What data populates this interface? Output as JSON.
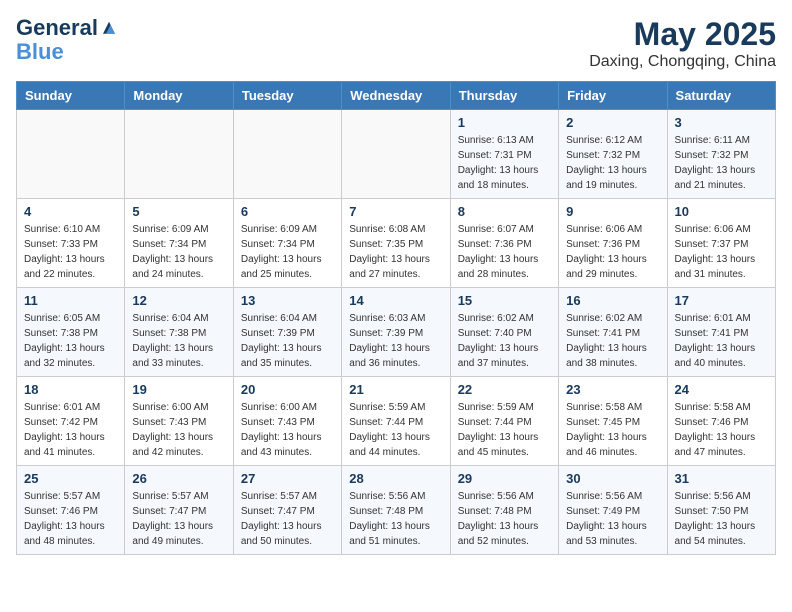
{
  "logo": {
    "line1": "General",
    "line2": "Blue"
  },
  "title": "May 2025",
  "location": "Daxing, Chongqing, China",
  "weekdays": [
    "Sunday",
    "Monday",
    "Tuesday",
    "Wednesday",
    "Thursday",
    "Friday",
    "Saturday"
  ],
  "weeks": [
    [
      {
        "day": "",
        "detail": ""
      },
      {
        "day": "",
        "detail": ""
      },
      {
        "day": "",
        "detail": ""
      },
      {
        "day": "",
        "detail": ""
      },
      {
        "day": "1",
        "detail": "Sunrise: 6:13 AM\nSunset: 7:31 PM\nDaylight: 13 hours\nand 18 minutes."
      },
      {
        "day": "2",
        "detail": "Sunrise: 6:12 AM\nSunset: 7:32 PM\nDaylight: 13 hours\nand 19 minutes."
      },
      {
        "day": "3",
        "detail": "Sunrise: 6:11 AM\nSunset: 7:32 PM\nDaylight: 13 hours\nand 21 minutes."
      }
    ],
    [
      {
        "day": "4",
        "detail": "Sunrise: 6:10 AM\nSunset: 7:33 PM\nDaylight: 13 hours\nand 22 minutes."
      },
      {
        "day": "5",
        "detail": "Sunrise: 6:09 AM\nSunset: 7:34 PM\nDaylight: 13 hours\nand 24 minutes."
      },
      {
        "day": "6",
        "detail": "Sunrise: 6:09 AM\nSunset: 7:34 PM\nDaylight: 13 hours\nand 25 minutes."
      },
      {
        "day": "7",
        "detail": "Sunrise: 6:08 AM\nSunset: 7:35 PM\nDaylight: 13 hours\nand 27 minutes."
      },
      {
        "day": "8",
        "detail": "Sunrise: 6:07 AM\nSunset: 7:36 PM\nDaylight: 13 hours\nand 28 minutes."
      },
      {
        "day": "9",
        "detail": "Sunrise: 6:06 AM\nSunset: 7:36 PM\nDaylight: 13 hours\nand 29 minutes."
      },
      {
        "day": "10",
        "detail": "Sunrise: 6:06 AM\nSunset: 7:37 PM\nDaylight: 13 hours\nand 31 minutes."
      }
    ],
    [
      {
        "day": "11",
        "detail": "Sunrise: 6:05 AM\nSunset: 7:38 PM\nDaylight: 13 hours\nand 32 minutes."
      },
      {
        "day": "12",
        "detail": "Sunrise: 6:04 AM\nSunset: 7:38 PM\nDaylight: 13 hours\nand 33 minutes."
      },
      {
        "day": "13",
        "detail": "Sunrise: 6:04 AM\nSunset: 7:39 PM\nDaylight: 13 hours\nand 35 minutes."
      },
      {
        "day": "14",
        "detail": "Sunrise: 6:03 AM\nSunset: 7:39 PM\nDaylight: 13 hours\nand 36 minutes."
      },
      {
        "day": "15",
        "detail": "Sunrise: 6:02 AM\nSunset: 7:40 PM\nDaylight: 13 hours\nand 37 minutes."
      },
      {
        "day": "16",
        "detail": "Sunrise: 6:02 AM\nSunset: 7:41 PM\nDaylight: 13 hours\nand 38 minutes."
      },
      {
        "day": "17",
        "detail": "Sunrise: 6:01 AM\nSunset: 7:41 PM\nDaylight: 13 hours\nand 40 minutes."
      }
    ],
    [
      {
        "day": "18",
        "detail": "Sunrise: 6:01 AM\nSunset: 7:42 PM\nDaylight: 13 hours\nand 41 minutes."
      },
      {
        "day": "19",
        "detail": "Sunrise: 6:00 AM\nSunset: 7:43 PM\nDaylight: 13 hours\nand 42 minutes."
      },
      {
        "day": "20",
        "detail": "Sunrise: 6:00 AM\nSunset: 7:43 PM\nDaylight: 13 hours\nand 43 minutes."
      },
      {
        "day": "21",
        "detail": "Sunrise: 5:59 AM\nSunset: 7:44 PM\nDaylight: 13 hours\nand 44 minutes."
      },
      {
        "day": "22",
        "detail": "Sunrise: 5:59 AM\nSunset: 7:44 PM\nDaylight: 13 hours\nand 45 minutes."
      },
      {
        "day": "23",
        "detail": "Sunrise: 5:58 AM\nSunset: 7:45 PM\nDaylight: 13 hours\nand 46 minutes."
      },
      {
        "day": "24",
        "detail": "Sunrise: 5:58 AM\nSunset: 7:46 PM\nDaylight: 13 hours\nand 47 minutes."
      }
    ],
    [
      {
        "day": "25",
        "detail": "Sunrise: 5:57 AM\nSunset: 7:46 PM\nDaylight: 13 hours\nand 48 minutes."
      },
      {
        "day": "26",
        "detail": "Sunrise: 5:57 AM\nSunset: 7:47 PM\nDaylight: 13 hours\nand 49 minutes."
      },
      {
        "day": "27",
        "detail": "Sunrise: 5:57 AM\nSunset: 7:47 PM\nDaylight: 13 hours\nand 50 minutes."
      },
      {
        "day": "28",
        "detail": "Sunrise: 5:56 AM\nSunset: 7:48 PM\nDaylight: 13 hours\nand 51 minutes."
      },
      {
        "day": "29",
        "detail": "Sunrise: 5:56 AM\nSunset: 7:48 PM\nDaylight: 13 hours\nand 52 minutes."
      },
      {
        "day": "30",
        "detail": "Sunrise: 5:56 AM\nSunset: 7:49 PM\nDaylight: 13 hours\nand 53 minutes."
      },
      {
        "day": "31",
        "detail": "Sunrise: 5:56 AM\nSunset: 7:50 PM\nDaylight: 13 hours\nand 54 minutes."
      }
    ]
  ]
}
